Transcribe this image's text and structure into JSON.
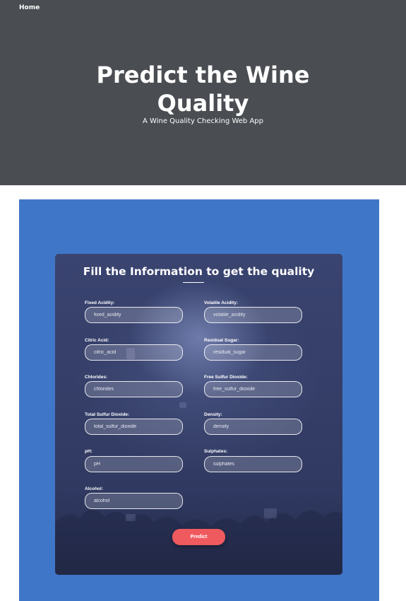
{
  "nav": {
    "home": "Home"
  },
  "hero": {
    "title_line1": "Predict the Wine",
    "title_line2": "Quality",
    "subtitle": "A Wine Quality Checking Web App"
  },
  "form": {
    "title": "Fill the Information to get the quality",
    "fields": [
      {
        "label": "Fixed Acidity:",
        "placeholder": "fixed_acidity"
      },
      {
        "label": "Volatile Acidity:",
        "placeholder": "volatile_acidity"
      },
      {
        "label": "Citric Acid:",
        "placeholder": "citric_acid"
      },
      {
        "label": "Residual  Sugar:",
        "placeholder": "residual_sugar"
      },
      {
        "label": "Chlorides:",
        "placeholder": "chlorides"
      },
      {
        "label": "Free  Sulfur Dioxide:",
        "placeholder": "free_sulfur_dioxide"
      },
      {
        "label": "Total  Sulfur Dioxide:",
        "placeholder": "total_sulfur_dioxide"
      },
      {
        "label": "Density:",
        "placeholder": "density"
      },
      {
        "label": "pH:",
        "placeholder": "pH"
      },
      {
        "label": "Sulphates:",
        "placeholder": "sulphates"
      },
      {
        "label": "Alcohol:",
        "placeholder": "alcohol"
      }
    ],
    "submit_label": "Predict"
  },
  "colors": {
    "hero_bg": "#4a4d52",
    "section_bg": "#4076c8",
    "card_bg": "#333d66",
    "button_bg": "#ef5a5f"
  }
}
